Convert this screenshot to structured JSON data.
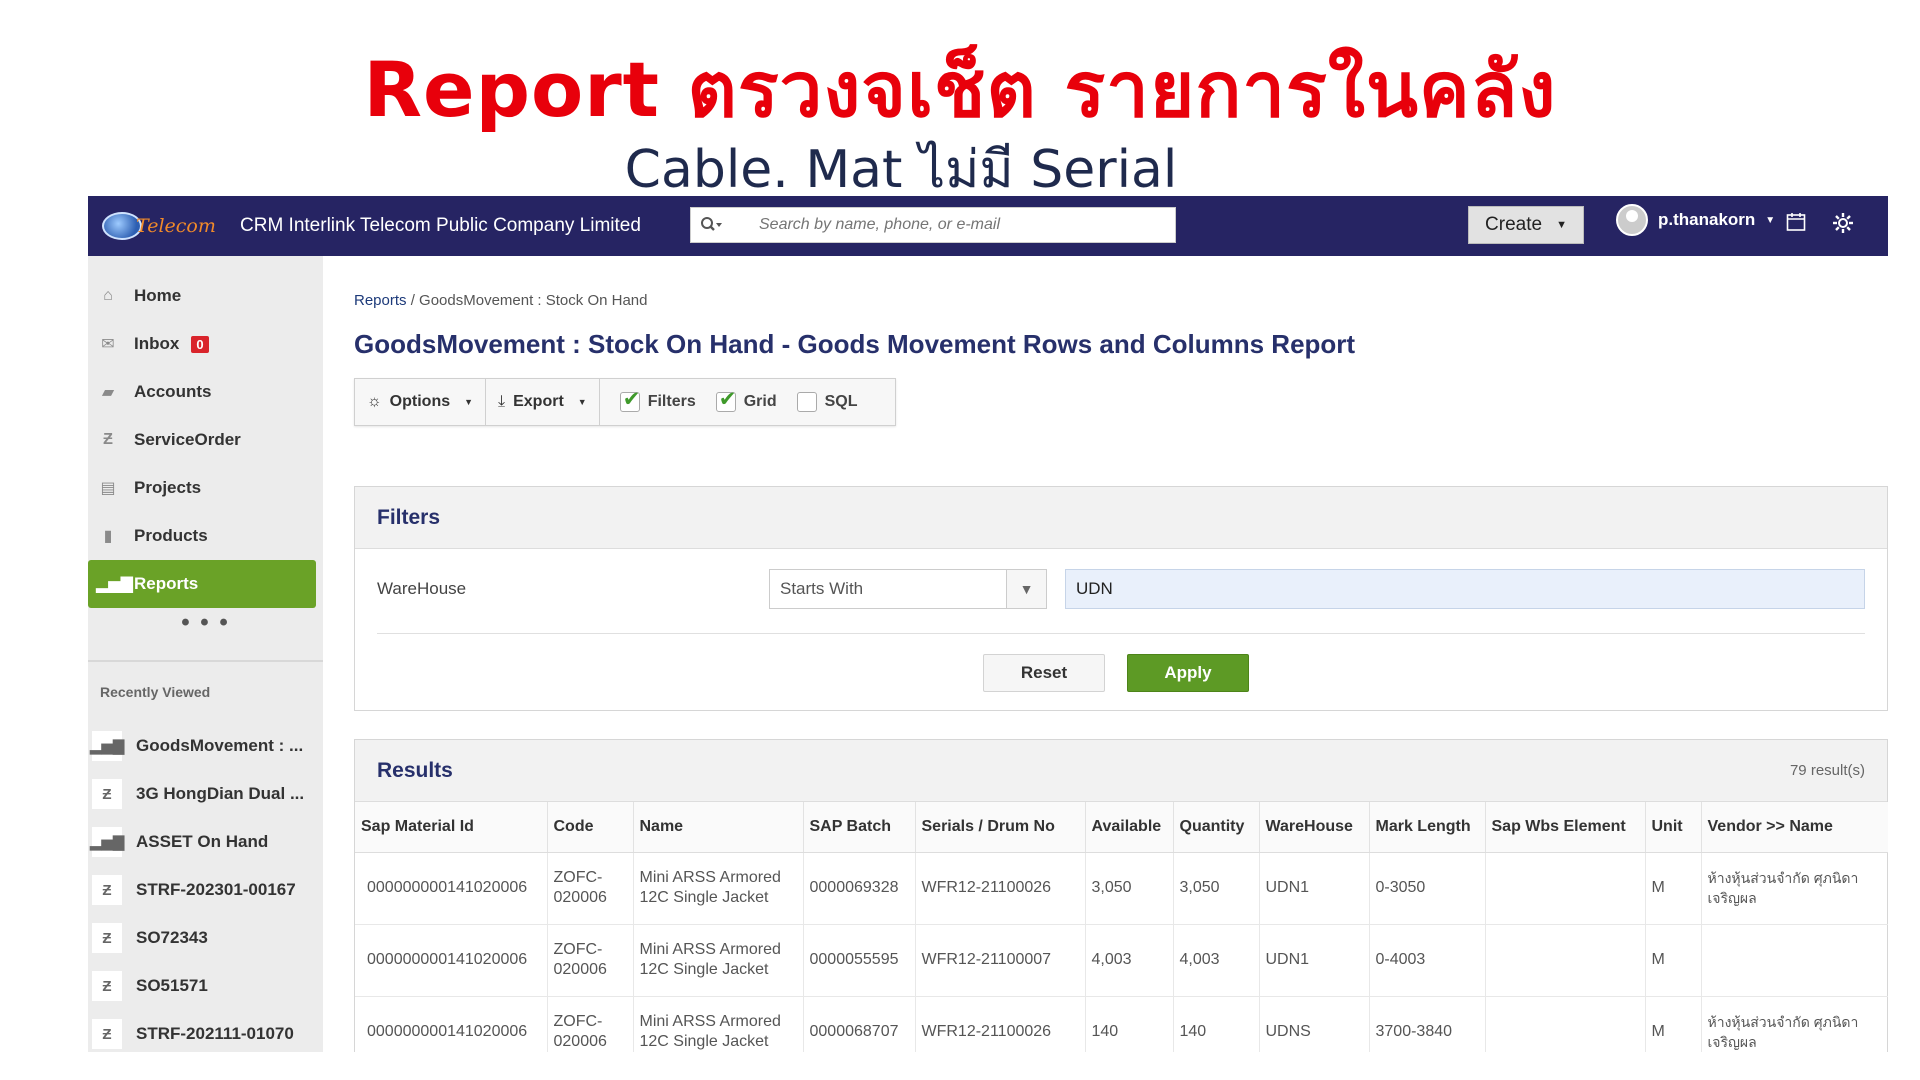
{
  "slide": {
    "title": "Report ตรวงจเช็ต รายการในคลัง",
    "subtitle": "Cable. Mat ไม่มี Serial"
  },
  "header": {
    "brand": "Telecom",
    "company": "CRM Interlink Telecom Public Company Limited",
    "search_placeholder": "Search by name, phone, or e-mail",
    "create_label": "Create",
    "username": "p.thanakorn"
  },
  "sidebar": {
    "items": [
      {
        "label": "Home",
        "icon": "home-icon"
      },
      {
        "label": "Inbox",
        "icon": "envelope-icon",
        "badge": "0"
      },
      {
        "label": "Accounts",
        "icon": "folder-icon"
      },
      {
        "label": "ServiceOrder",
        "icon": "z-icon"
      },
      {
        "label": "Projects",
        "icon": "briefcase-icon"
      },
      {
        "label": "Products",
        "icon": "book-icon"
      },
      {
        "label": "Reports",
        "icon": "bar-chart-icon"
      }
    ],
    "more": "• • •",
    "recent_title": "Recently Viewed",
    "recent": [
      {
        "label": "GoodsMovement : ...",
        "icon": "bar-chart-icon"
      },
      {
        "label": "3G HongDian Dual ...",
        "icon": "z-icon"
      },
      {
        "label": "ASSET On Hand",
        "icon": "bar-chart-icon"
      },
      {
        "label": "STRF-202301-00167",
        "icon": "z-icon"
      },
      {
        "label": "SO72343",
        "icon": "z-icon"
      },
      {
        "label": "SO51571",
        "icon": "z-icon"
      },
      {
        "label": "STRF-202111-01070",
        "icon": "z-icon"
      }
    ]
  },
  "main": {
    "breadcrumb_link": "Reports",
    "breadcrumb_rest": " / GoodsMovement : Stock On Hand",
    "title": "GoodsMovement : Stock On Hand - Goods Movement Rows and Columns Report",
    "toolbar": {
      "options": "Options",
      "export": "Export",
      "filters": "Filters",
      "grid": "Grid",
      "sql": "SQL",
      "filters_checked": true,
      "grid_checked": true,
      "sql_checked": false
    },
    "filters": {
      "heading": "Filters",
      "field_label": "WareHouse",
      "operator": "Starts With",
      "value": "UDN",
      "reset": "Reset",
      "apply": "Apply"
    },
    "results": {
      "heading": "Results",
      "count": "79 result(s)",
      "columns": [
        "Sap Material Id",
        "Code",
        "Name",
        "SAP Batch",
        "Serials / Drum No",
        "Available",
        "Quantity",
        "WareHouse",
        "Mark Length",
        "Sap Wbs Element",
        "Unit",
        "Vendor >> Name"
      ],
      "rows": [
        [
          "000000000141020006",
          "ZOFC-020006",
          "Mini ARSS Armored 12C Single Jacket",
          "0000069328",
          "WFR12-21100026",
          "3,050",
          "3,050",
          "UDN1",
          "0-3050",
          "",
          "M",
          "ห้างหุ้นส่วนจำกัด ศุภนิดาเจริญผล"
        ],
        [
          "000000000141020006",
          "ZOFC-020006",
          "Mini ARSS Armored 12C Single Jacket",
          "0000055595",
          "WFR12-21100007",
          "4,003",
          "4,003",
          "UDN1",
          "0-4003",
          "",
          "M",
          ""
        ],
        [
          "000000000141020006",
          "ZOFC-020006",
          "Mini ARSS Armored 12C Single Jacket",
          "0000068707",
          "WFR12-21100026",
          "140",
          "140",
          "UDNS",
          "3700-3840",
          "",
          "M",
          "ห้างหุ้นส่วนจำกัด ศุภนิดาเจริญผล"
        ]
      ]
    }
  },
  "colors": {
    "header_bg": "#262463",
    "accent_green": "#6aa227",
    "title_red": "#e8000b",
    "heading_navy": "#27306b"
  }
}
